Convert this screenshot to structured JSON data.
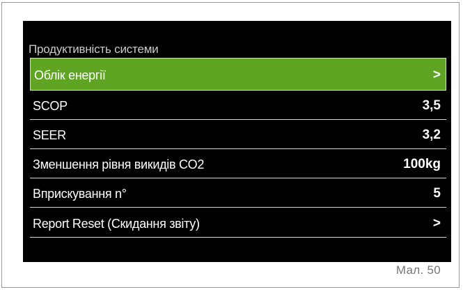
{
  "screen": {
    "title": "Продуктивність системи",
    "colors": {
      "background": "#000000",
      "selected": "#5fa523",
      "text": "#ffffff",
      "title_text": "#c9c9c9"
    }
  },
  "menu": {
    "items": [
      {
        "label": "Облік енергії",
        "value": ">",
        "selected": true
      },
      {
        "label": "SCOP",
        "value": "3,5",
        "selected": false
      },
      {
        "label": "SEER",
        "value": "3,2",
        "selected": false
      },
      {
        "label": "Зменшення рівня викидів CO2",
        "value": "100kg",
        "selected": false
      },
      {
        "label": "Вприскування n°",
        "value": "5",
        "selected": false
      },
      {
        "label": "Report Reset (Скидання звіту)",
        "value": ">",
        "selected": false
      }
    ]
  },
  "caption": "Мал. 50"
}
